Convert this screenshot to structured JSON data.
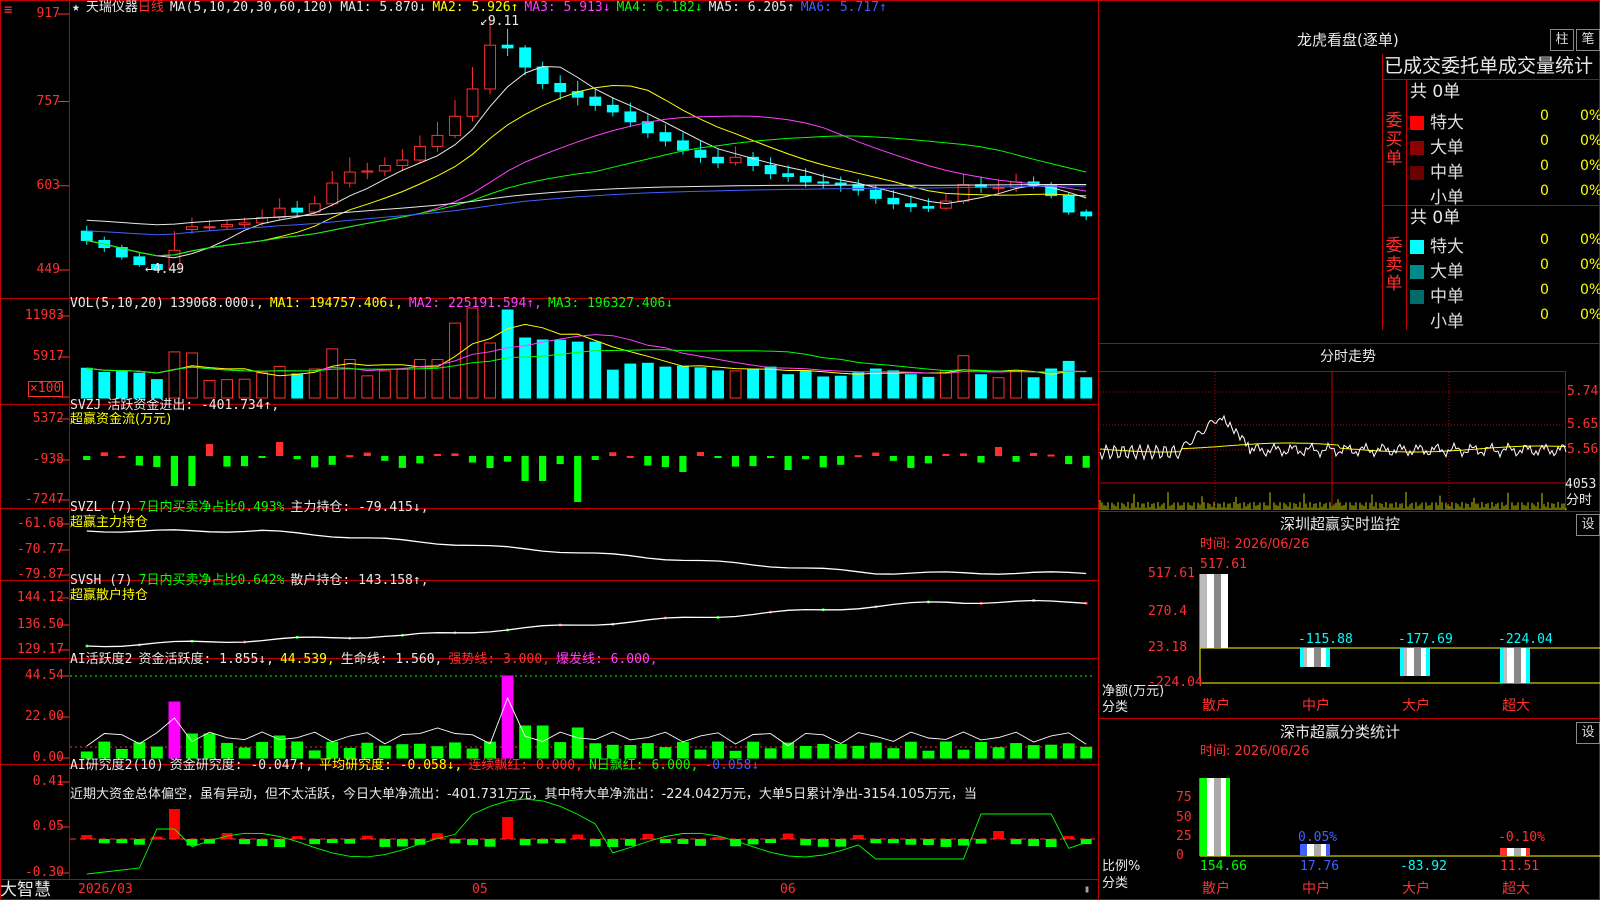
{
  "header": {
    "star": "★",
    "name": "天瑞仪器",
    "period": "日线",
    "ma_def": "MA(5,10,20,30,60,120)",
    "ma_values": [
      {
        "text": "MA1: 5.870↓",
        "color": "#e8e8e8"
      },
      {
        "text": "MA2: 5.926↑",
        "color": "#ffff00"
      },
      {
        "text": "MA3: 5.913↓",
        "color": "#ff40ff"
      },
      {
        "text": "MA4: 6.182↓",
        "color": "#00ff00"
      },
      {
        "text": "MA5: 6.205↑",
        "color": "#e8e8e8"
      },
      {
        "text": "MA6: 5.717↑",
        "color": "#4060ff"
      }
    ]
  },
  "price_axis": {
    "ticks": [
      "917",
      "757",
      "603",
      "449"
    ],
    "top_marker": "≡"
  },
  "high_label": "9.11",
  "low_label": "4.49",
  "vol_panel": {
    "header": [
      {
        "text": "VOL(5,10,20)",
        "color": "#e8e8e8"
      },
      {
        "text": "139068.000↓,",
        "color": "#e8e8e8"
      },
      {
        "text": "MA1: 194757.406↓,",
        "color": "#ffff00"
      },
      {
        "text": "MA2: 225191.594↑,",
        "color": "#ff40ff"
      },
      {
        "text": "MA3: 196327.406↓",
        "color": "#00ff00"
      }
    ],
    "ticks": [
      "11983",
      "5917"
    ],
    "unit": "×100"
  },
  "svzj_panel": {
    "header": [
      {
        "text": "SVZJ",
        "color": "#e8e8e8"
      },
      {
        "text": "活跃资金进出: -401.734↑,",
        "color": "#e8e8e8"
      }
    ],
    "sub": "超赢资金流(万元)",
    "ticks": [
      "5372",
      "-938",
      "-7247"
    ]
  },
  "svzl_panel": {
    "header": [
      {
        "text": "SVZL (7)",
        "color": "#e8e8e8"
      },
      {
        "text": "7日内买卖净占比0.493%",
        "color": "#00ff00"
      },
      {
        "text": "主力持仓: -79.415↓,",
        "color": "#e8e8e8"
      }
    ],
    "sub": "超赢主力持仓",
    "ticks": [
      "-61.68",
      "-70.77",
      "-79.87"
    ]
  },
  "svsh_panel": {
    "header": [
      {
        "text": "SVSH (7)",
        "color": "#e8e8e8"
      },
      {
        "text": "7日内买卖净占比0.642%",
        "color": "#00ff00"
      },
      {
        "text": "散户持仓: 143.158↑,",
        "color": "#e8e8e8"
      }
    ],
    "sub": "超赢散户持仓",
    "ticks": [
      "144.12",
      "136.50",
      "129.17"
    ]
  },
  "ai1_panel": {
    "header": [
      {
        "text": "AI活跃度2",
        "color": "#e8e8e8"
      },
      {
        "text": "资金活跃度: 1.855↓,",
        "color": "#e8e8e8"
      },
      {
        "text": "44.539,",
        "color": "#ffff00"
      },
      {
        "text": "生命线: 1.560,",
        "color": "#e8e8e8"
      },
      {
        "text": "强势线: 3.000,",
        "color": "#ff3030"
      },
      {
        "text": "爆发线: 6.000,",
        "color": "#ff40ff"
      }
    ],
    "ticks": [
      "44.54",
      "22.00",
      "0.00"
    ]
  },
  "ai2_panel": {
    "header": [
      {
        "text": "AI研究度2(10)",
        "color": "#e8e8e8"
      },
      {
        "text": "资金研究度: -0.047↑,",
        "color": "#e8e8e8"
      },
      {
        "text": "平均研究度: -0.058↓,",
        "color": "#ffff00"
      },
      {
        "text": "连续飘红: 0.000,",
        "color": "#ff3030"
      },
      {
        "text": "N日飘红: 6.000,",
        "color": "#00ff00"
      },
      {
        "text": "-0.058↓",
        "color": "#4060ff"
      }
    ],
    "comment": "近期大资金总体偏空，虽有异动，但不太活跃，今日大单净流出：-401.731万元，其中特大单净流出：-224.042万元，大单5日累计净出-3154.105万元，当",
    "ticks": [
      "0.41",
      "0.05",
      "-0.30"
    ]
  },
  "bottom_bar": {
    "brand": "大智慧",
    "dates": [
      "2026/03",
      "05",
      "06"
    ]
  },
  "chart_data": {
    "type": "candlestick",
    "ylim": [
      4.49,
      9.17
    ],
    "y_ticks": [
      9.17,
      7.57,
      6.03,
      4.49
    ],
    "opens": [
      5.2,
      5.03,
      4.9,
      4.73,
      4.59,
      4.5,
      5.23,
      5.28,
      5.28,
      5.32,
      5.35,
      5.45,
      5.62,
      5.55,
      5.7,
      6.08,
      6.28,
      6.3,
      6.4,
      6.5,
      6.75,
      6.95,
      7.3,
      7.8,
      8.6,
      8.55,
      8.2,
      7.9,
      7.75,
      7.65,
      7.5,
      7.38,
      7.2,
      7.0,
      6.85,
      6.68,
      6.55,
      6.45,
      6.55,
      6.4,
      6.25,
      6.2,
      6.1,
      6.08,
      6.05,
      5.95,
      5.8,
      5.7,
      5.65,
      5.62,
      5.75,
      6.05,
      6.0,
      6.0,
      6.1,
      6.05,
      5.85,
      5.55
    ],
    "closes": [
      5.03,
      4.9,
      4.73,
      4.59,
      4.5,
      4.85,
      5.28,
      5.28,
      5.32,
      5.35,
      5.45,
      5.62,
      5.55,
      5.7,
      6.08,
      6.28,
      6.3,
      6.4,
      6.5,
      6.75,
      6.95,
      7.3,
      7.8,
      8.6,
      8.55,
      8.2,
      7.9,
      7.75,
      7.65,
      7.5,
      7.38,
      7.2,
      7.0,
      6.85,
      6.68,
      6.55,
      6.45,
      6.55,
      6.4,
      6.25,
      6.2,
      6.1,
      6.08,
      6.05,
      5.95,
      5.8,
      5.7,
      5.65,
      5.62,
      5.75,
      6.05,
      6.0,
      6.0,
      6.1,
      6.05,
      5.85,
      5.55,
      5.48
    ],
    "highs": [
      5.3,
      5.1,
      4.95,
      4.8,
      4.62,
      5.2,
      5.45,
      5.4,
      5.4,
      5.45,
      5.6,
      5.8,
      5.75,
      5.85,
      6.3,
      6.55,
      6.45,
      6.55,
      6.7,
      6.95,
      7.2,
      7.6,
      8.2,
      9.11,
      8.9,
      8.6,
      8.3,
      8.05,
      7.95,
      7.8,
      7.65,
      7.55,
      7.35,
      7.15,
      7.0,
      6.85,
      6.7,
      6.75,
      6.65,
      6.55,
      6.4,
      6.35,
      6.25,
      6.2,
      6.15,
      6.05,
      5.95,
      5.85,
      5.8,
      5.9,
      6.25,
      6.2,
      6.15,
      6.25,
      6.2,
      6.1,
      5.9,
      5.6
    ],
    "lows": [
      4.95,
      4.82,
      4.68,
      4.55,
      4.49,
      4.6,
      5.15,
      5.2,
      5.22,
      5.25,
      5.3,
      5.4,
      5.45,
      5.5,
      5.65,
      6.0,
      6.15,
      6.2,
      6.3,
      6.45,
      6.65,
      6.9,
      7.2,
      7.7,
      8.4,
      8.05,
      7.8,
      7.6,
      7.5,
      7.4,
      7.3,
      7.1,
      6.9,
      6.75,
      6.6,
      6.45,
      6.35,
      6.4,
      6.3,
      6.15,
      6.1,
      6.0,
      5.98,
      5.92,
      5.85,
      5.7,
      5.6,
      5.55,
      5.55,
      5.58,
      5.7,
      5.9,
      5.88,
      5.92,
      5.98,
      5.8,
      5.5,
      5.4
    ],
    "ma_colors": [
      "#e8e8e8",
      "#ffff00",
      "#ff40ff",
      "#00ff00",
      "#e8e8e8",
      "#4060ff"
    ]
  },
  "right_panel": {
    "toggle_buttons": [
      "柱",
      "笔"
    ],
    "title": "龙虎看盘(逐单)",
    "subtitle": "已成交委托单成交量统计",
    "buy": {
      "side_label": "委买单",
      "total": "共 0单",
      "rows": [
        {
          "label": "特大",
          "color": "#ff0000",
          "count": "0",
          "pct": "0%"
        },
        {
          "label": "大单",
          "color": "#8b0000",
          "count": "0",
          "pct": "0%"
        },
        {
          "label": "中单",
          "color": "#6b0000",
          "count": "0",
          "pct": "0%"
        },
        {
          "label": "小单",
          "color": "#000000",
          "count": "0",
          "pct": "0%"
        }
      ]
    },
    "sell": {
      "side_label": "委卖单",
      "total": "共 0单",
      "rows": [
        {
          "label": "特大",
          "color": "#00ffff",
          "count": "0",
          "pct": "0%"
        },
        {
          "label": "大单",
          "color": "#008b8b",
          "count": "0",
          "pct": "0%"
        },
        {
          "label": "中单",
          "color": "#006b6b",
          "count": "0",
          "pct": "0%"
        },
        {
          "label": "小单",
          "color": "#000000",
          "count": "0",
          "pct": "0%"
        }
      ]
    },
    "intraday": {
      "title": "分时走势",
      "ticks": [
        "5.74",
        "5.65",
        "5.56"
      ],
      "vol_label": "4053",
      "vol_unit": "分时"
    },
    "monitor": {
      "title": "深圳超赢实时监控",
      "set": "设",
      "time": "时间: 2026/06/26",
      "yticks": [
        "517.61",
        "270.4",
        "23.18",
        "-224.04"
      ],
      "top_value": "517.61",
      "bars": [
        {
          "cat": "散户",
          "value": "517.61"
        },
        {
          "cat": "中户",
          "value": "-115.88"
        },
        {
          "cat": "大户",
          "value": "-177.69"
        },
        {
          "cat": "超大",
          "value": "-224.04"
        }
      ],
      "axis_label": "净额(万元)",
      "cat_label": "分类"
    },
    "stats": {
      "title": "深市超赢分类统计",
      "set": "设",
      "time": "时间: 2026/06/26",
      "yticks": [
        "75",
        "50",
        "25",
        "0"
      ],
      "bars": [
        {
          "cat": "散户",
          "value": "154.66",
          "pct": ""
        },
        {
          "cat": "中户",
          "value": "17.76",
          "pct": "0.05%"
        },
        {
          "cat": "大户",
          "value": "-83.92",
          "pct": ""
        },
        {
          "cat": "超大",
          "value": "11.51",
          "pct": "-0.10%"
        }
      ],
      "axis_label": "比例%",
      "cat_label": "分类"
    }
  }
}
